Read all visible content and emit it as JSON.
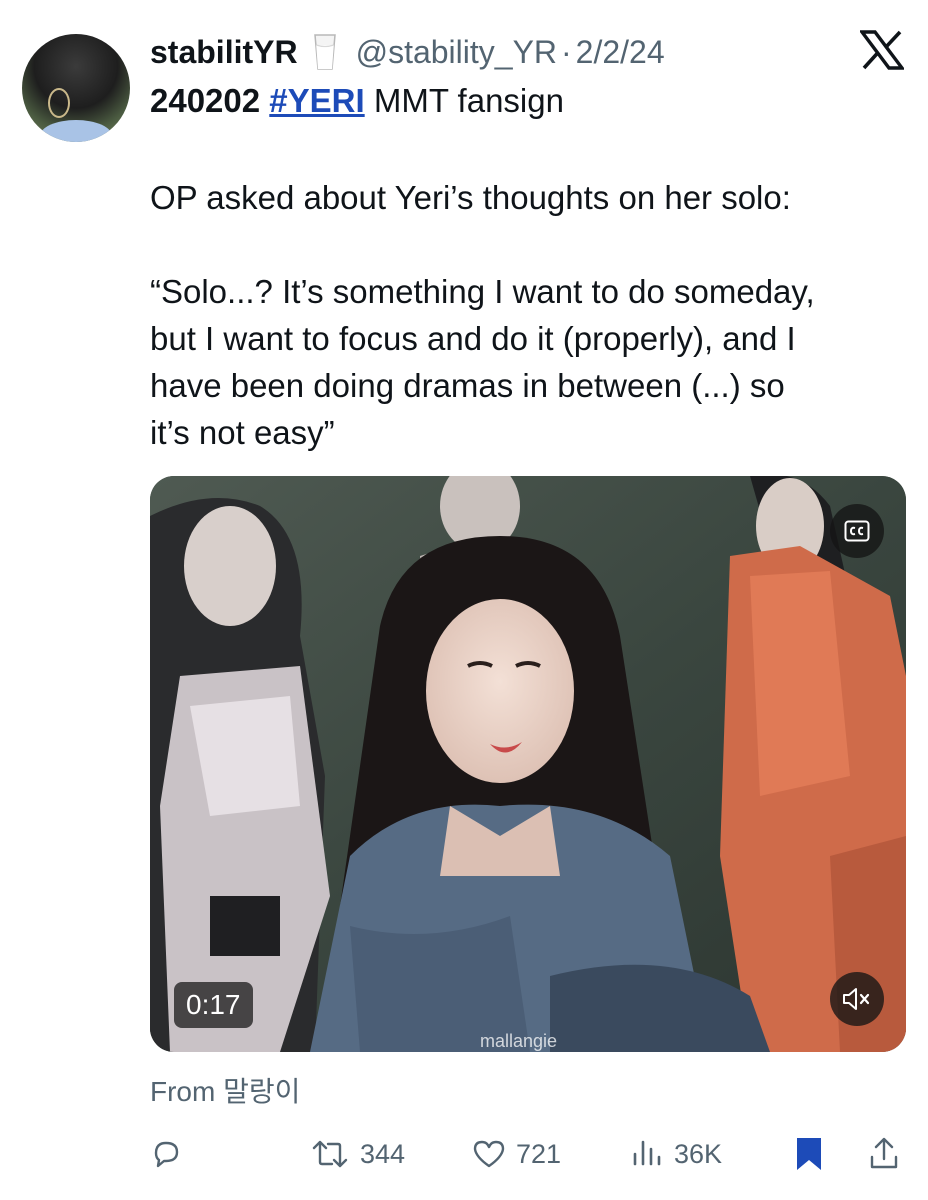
{
  "post": {
    "display_name": "stabilitYR",
    "name_emoji": "milk-glass-icon",
    "handle": "@stability_YR",
    "separator": "·",
    "date": "2/2/24",
    "headline_date": "240202",
    "hashtag": "#YERI",
    "headline_rest": "MMT fansign",
    "body_lines": [
      "OP asked about Yeri’s thoughts on her solo:",
      "“Solo...? It’s something I want to do someday,",
      "but I want to focus and do it (properly), and I",
      "have been doing dramas in between (...) so",
      "it’s not easy”"
    ],
    "source": "From 말랑이"
  },
  "media": {
    "duration": "0:17",
    "watermark": "mallangie",
    "cc_icon": "cc-icon",
    "mute_icon": "muted-speaker-icon"
  },
  "actions": {
    "reply": {
      "icon": "reply-bubble-icon"
    },
    "repost": {
      "icon": "repost-icon",
      "count": "344"
    },
    "like": {
      "icon": "heart-icon",
      "count": "721"
    },
    "views": {
      "icon": "views-bars-icon",
      "count": "36K"
    },
    "bookmark": {
      "icon": "bookmark-icon",
      "color": "#1d4bb8"
    },
    "share": {
      "icon": "share-icon"
    }
  },
  "colors": {
    "text": "#0f1419",
    "secondary": "#536471",
    "hashtag": "#1d4bb8"
  }
}
